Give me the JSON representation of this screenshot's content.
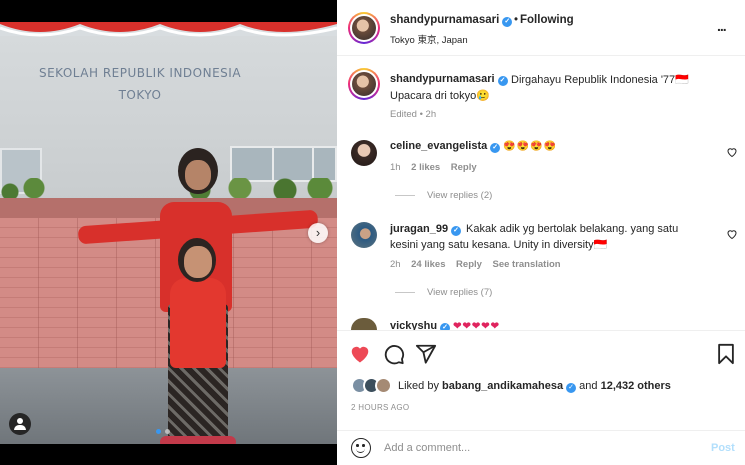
{
  "media": {
    "sign_line1": "SEKOLAH REPUBLIK INDONESIA",
    "sign_line2": "TOKYO",
    "next_icon": "chevron-right-icon",
    "carousel_dots": 2,
    "carousel_active": 0,
    "tag_icon": "user-tag-icon"
  },
  "header": {
    "username": "shandypurnamasari",
    "dot": "•",
    "follow_label": "Following",
    "location": "Tokyo 東京, Japan",
    "more_label": "..."
  },
  "caption": {
    "username": "shandypurnamasari",
    "line1": "Dirgahayu Republik Indonesia '77🇮🇩",
    "line2": "Upacara dri tokyo🥲",
    "time": "Edited • 2h"
  },
  "comments": [
    {
      "username": "celine_evangelista",
      "text": "😍😍😍😍",
      "time": "1h",
      "likes": "2 likes",
      "reply": "Reply",
      "view_replies": "View replies (2)"
    },
    {
      "username": "juragan_99",
      "text1": "Kakak adik yg bertolak belakang. yang satu",
      "text2": "kesini yang satu kesana. Unity in diversity🇮🇩",
      "time": "2h",
      "likes": "24 likes",
      "reply": "Reply",
      "translate": "See translation",
      "view_replies": "View replies (7)"
    },
    {
      "username": "vickyshu",
      "text": "❤❤❤❤❤"
    }
  ],
  "actions": {
    "like_icon": "heart-filled-icon",
    "comment_icon": "comment-icon",
    "share_icon": "share-icon",
    "save_icon": "bookmark-icon",
    "liked_prefix": "Liked by",
    "liked_user": "babang_andikamahesa",
    "liked_and": "and",
    "liked_others": "12,432 others",
    "date": "2 HOURS AGO"
  },
  "add_comment": {
    "placeholder": "Add a comment...",
    "post_label": "Post"
  },
  "colors": {
    "accent": "#3897f0",
    "like_red": "#ed4956",
    "post_disabled": "#b2dffc",
    "muted": "#8e8e8e"
  }
}
